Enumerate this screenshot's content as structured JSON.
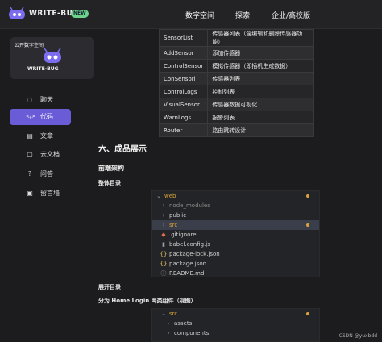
{
  "header": {
    "brand": "WRITE-BUG",
    "badge": "NEW",
    "nav": [
      "数字空间",
      "探索",
      "企业/高校版"
    ]
  },
  "sidebar": {
    "card_title": "公开数字空间",
    "card_brand": "WRITE-BUG",
    "items": [
      {
        "label": "聊天",
        "icon": "chat-icon",
        "glyph": "◌"
      },
      {
        "label": "代码",
        "icon": "code-icon",
        "glyph": "</>"
      },
      {
        "label": "文章",
        "icon": "article-icon",
        "glyph": "▤"
      },
      {
        "label": "云文档",
        "icon": "cloud-doc-icon",
        "glyph": "▢"
      },
      {
        "label": "问答",
        "icon": "qa-icon",
        "glyph": "?"
      },
      {
        "label": "留言墙",
        "icon": "message-wall-icon",
        "glyph": "▣"
      }
    ]
  },
  "table": {
    "rows": [
      [
        "SensorList",
        "传感器列表（含编辑和删除传感器功能）"
      ],
      [
        "AddSensor",
        "添加传感器"
      ],
      [
        "ControlSensor",
        "模拟传感器（即插机生成数据）"
      ],
      [
        "ConSensorl",
        "传感器列表"
      ],
      [
        "ControlLogs",
        "控制列表"
      ],
      [
        "VisualSensor",
        "传感器数据可视化"
      ],
      [
        "WarnLogs",
        "报警列表"
      ],
      [
        "Router",
        "路由跳转设计"
      ]
    ]
  },
  "content": {
    "section_title": "六、成品展示",
    "front_title": "前端架构",
    "overall_dir": "整体目录",
    "expand_dir": "展开目录",
    "split_desc": "分为 Home Login 两类组件（视图）"
  },
  "tree1": {
    "items": [
      {
        "name": "web",
        "glyph": "⌄",
        "indent": 0,
        "dot": true,
        "color": "#d9a43b"
      },
      {
        "name": "node_modules",
        "glyph": "›",
        "indent": 1,
        "dot": false,
        "color": "#8a8a8a"
      },
      {
        "name": "public",
        "glyph": "›",
        "indent": 1,
        "dot": false,
        "color": "#cfcfcf"
      },
      {
        "name": "src",
        "glyph": "›",
        "indent": 1,
        "dot": true,
        "color": "#d9a43b"
      },
      {
        "name": ".gitignore",
        "glyph": "◆",
        "indent": 1,
        "dot": false,
        "color": "#cfcfcf"
      },
      {
        "name": "babel.config.js",
        "glyph": "▮",
        "indent": 1,
        "dot": false,
        "color": "#cfcfcf"
      },
      {
        "name": "package-lock.json",
        "glyph": "{}",
        "indent": 1,
        "dot": false,
        "color": "#cfcfcf"
      },
      {
        "name": "package.json",
        "glyph": "{}",
        "indent": 1,
        "dot": false,
        "color": "#cfcfcf"
      },
      {
        "name": "README.md",
        "glyph": "ⓘ",
        "indent": 1,
        "dot": false,
        "color": "#cfcfcf"
      }
    ]
  },
  "tree2": {
    "items": [
      {
        "name": "src",
        "glyph": "⌄",
        "indent": 1,
        "dot": true,
        "color": "#d9a43b"
      },
      {
        "name": "assets",
        "glyph": "›",
        "indent": 2,
        "dot": false,
        "color": "#cfcfcf"
      },
      {
        "name": "components",
        "glyph": "›",
        "indent": 2,
        "dot": false,
        "color": "#cfcfcf"
      }
    ]
  },
  "watermark": "CSDN @yuxbdd",
  "colors": {
    "accent": "#6a5cd6",
    "badge": "#6bd38a",
    "modified": "#d9a43b"
  }
}
